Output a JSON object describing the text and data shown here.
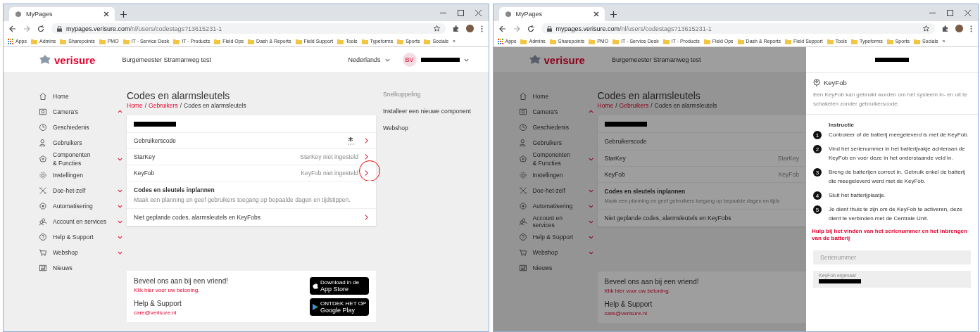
{
  "windows": [
    {
      "tab": {
        "title": "MyPages"
      },
      "url": {
        "host": "mypages.verisure.com",
        "path": "/nl/users/codestags?13615231-1"
      },
      "bookmarks": {
        "apps": "Apps",
        "folders": [
          "Admins",
          "Sharepoints",
          "PMO",
          "IT - Service Desk",
          "IT - Products",
          "Field Ops",
          "Dash & Reports",
          "Field Support",
          "Tools",
          "Typeforms",
          "Sports",
          "Socials"
        ],
        "more": "»"
      },
      "site": {
        "logo": "verisure",
        "address": "Burgemeester Stramanweg test",
        "language": "Nederlands",
        "avatar": "BV"
      },
      "page": {
        "dimmed": false,
        "sidebar": [
          {
            "label": "Home"
          },
          {
            "label": "Camera's",
            "expanded": true
          },
          {
            "label": "Geschiedenis"
          },
          {
            "label": "Gebruikers"
          },
          {
            "label": "Componenten & Functies",
            "expanded": false
          },
          {
            "label": "Instellingen"
          },
          {
            "label": "Doe-het-zelf",
            "expanded": false
          },
          {
            "label": "Automatisering",
            "expanded": false
          },
          {
            "label": "Account en services",
            "expanded": false
          },
          {
            "label": "Help & Support",
            "expanded": false
          },
          {
            "label": "Webshop",
            "expanded": false
          },
          {
            "label": "Nieuws"
          }
        ],
        "title": "Codes en alarmsleutels",
        "breadcrumb": {
          "separator": "/",
          "items": [
            {
              "label": "Home",
              "link": true
            },
            {
              "label": "Gebruikers",
              "link": true
            },
            {
              "label": "Codes en alarmsleutels",
              "link": false
            }
          ]
        },
        "card": [
          {
            "kind": "header"
          },
          {
            "kind": "code",
            "label": "Gebruikerscode",
            "chevron": true
          },
          {
            "kind": "value",
            "label": "StarKey",
            "value": "StarKey niet ingesteld",
            "chevron": true
          },
          {
            "kind": "value",
            "label": "KeyFob",
            "value": "KeyFob niet ingesteld",
            "chevron": true,
            "circled": true
          },
          {
            "kind": "schedule",
            "title": "Codes en sleutels inplannen",
            "description": "Maak een planning en geef gebruikers toegang op bepaalde dagen en tijdstippen."
          },
          {
            "kind": "link",
            "label": "Niet geplande codes, alarmsleutels en KeyFobs",
            "chevron": true
          }
        ],
        "footer": {
          "refer": "Beveel ons aan bij een vriend!",
          "refer_link": "Klik hier voor uw beloning.",
          "help_title": "Help & Support",
          "email": "care@verisure.nl",
          "badges": [
            {
              "kind": "apple",
              "small": "Download in de",
              "label": "App Store"
            },
            {
              "kind": "google",
              "small": "ONTDEK HET OP",
              "label": "Google Play"
            }
          ]
        },
        "shortcuts": {
          "heading": "Snelkoppeling",
          "links": [
            "Installeer een nieuwe component",
            "Webshop"
          ]
        }
      }
    },
    {
      "tab": {
        "title": "MyPages"
      },
      "url": {
        "host": "mypages.verisure.com",
        "path": "/nl/users/codestags?13615231-1"
      },
      "bookmarks": {
        "apps": "Apps",
        "folders": [
          "Admins",
          "Sharepoints",
          "PMO",
          "IT - Service Desk",
          "IT - Products",
          "Field Ops",
          "Dash & Reports",
          "Field Support",
          "Tools",
          "Typeforms",
          "Sports",
          "Socials"
        ],
        "more": "»"
      },
      "site": {
        "logo": "verisure",
        "address": "Burgemeester Stramanweg test"
      },
      "page": {
        "dimmed": true,
        "sidebar": [
          {
            "label": "Home"
          },
          {
            "label": "Camera's",
            "expanded": true
          },
          {
            "label": "Geschiedenis"
          },
          {
            "label": "Gebruikers"
          },
          {
            "label": "Componenten & Functies",
            "expanded": false
          },
          {
            "label": "Instellingen"
          },
          {
            "label": "Doe-het-zelf",
            "expanded": false
          },
          {
            "label": "Automatisering",
            "expanded": false
          },
          {
            "label": "Account en services",
            "expanded": false
          },
          {
            "label": "Help & Support",
            "expanded": false
          },
          {
            "label": "Webshop",
            "expanded": false
          },
          {
            "label": "Nieuws"
          }
        ],
        "title": "Codes en alarmsleutels",
        "breadcrumb": {
          "separator": "/",
          "items": [
            {
              "label": "Home",
              "link": true
            },
            {
              "label": "Gebruikers",
              "link": true
            },
            {
              "label": "Codes en alarmsleutels",
              "link": false
            }
          ]
        },
        "card": [
          {
            "kind": "header"
          },
          {
            "kind": "link",
            "label": "Gebruikerscode",
            "chevron": false
          },
          {
            "kind": "value",
            "label": "StarKey",
            "value": "StarKey",
            "chevron": false
          },
          {
            "kind": "value",
            "label": "KeyFob",
            "value": "KeyFob",
            "chevron": false
          },
          {
            "kind": "schedule",
            "title": "Codes en sleutels inplannen",
            "description": "Maak een planning en geef gebruikers toegang op bepaalde dagen en tijds"
          },
          {
            "kind": "link",
            "label": "Niet geplande codes, alarmsleutels en KeyFobs",
            "chevron": false
          }
        ],
        "footer": {
          "refer": "Beveel ons aan bij een vriend!",
          "refer_link": "Klik hier voor uw beloning.",
          "help_title": "Help & Support",
          "email": "care@verisure.nl"
        }
      },
      "drawer": {
        "title": "KeyFob",
        "description": "Een KeyFob kan gebruikt worden om het systeem in- en uit te schakelen zonder gebruikerscode.",
        "instruction_title": "Instructie",
        "steps": [
          {
            "number": "1",
            "text": "Controleer of de batterij meegeleverd is met de KeyFob."
          },
          {
            "number": "2",
            "text": "Vind het serienummer in het batterijvakje achteraan de KeyFob en voer deze in het onderstaande veld in."
          },
          {
            "number": "3",
            "text": "Breng de batterijen correct in. Gebruik enkel de batterij die meegeleverd werd met de KeyFob."
          },
          {
            "number": "4",
            "text": "Sluit het batterijplaatje."
          },
          {
            "number": "5",
            "text": "Je dient thuis te zijn om de KeyFob te activeren, deze dient te verbinden met de Centrale Unit."
          }
        ],
        "help_link": "Hulp bij het vinden van het serienummer en het inbrengen van de batterij",
        "fields": [
          {
            "placeholder": "Serienummer"
          },
          {
            "label": "KeyFob eigenaar"
          }
        ]
      }
    }
  ]
}
